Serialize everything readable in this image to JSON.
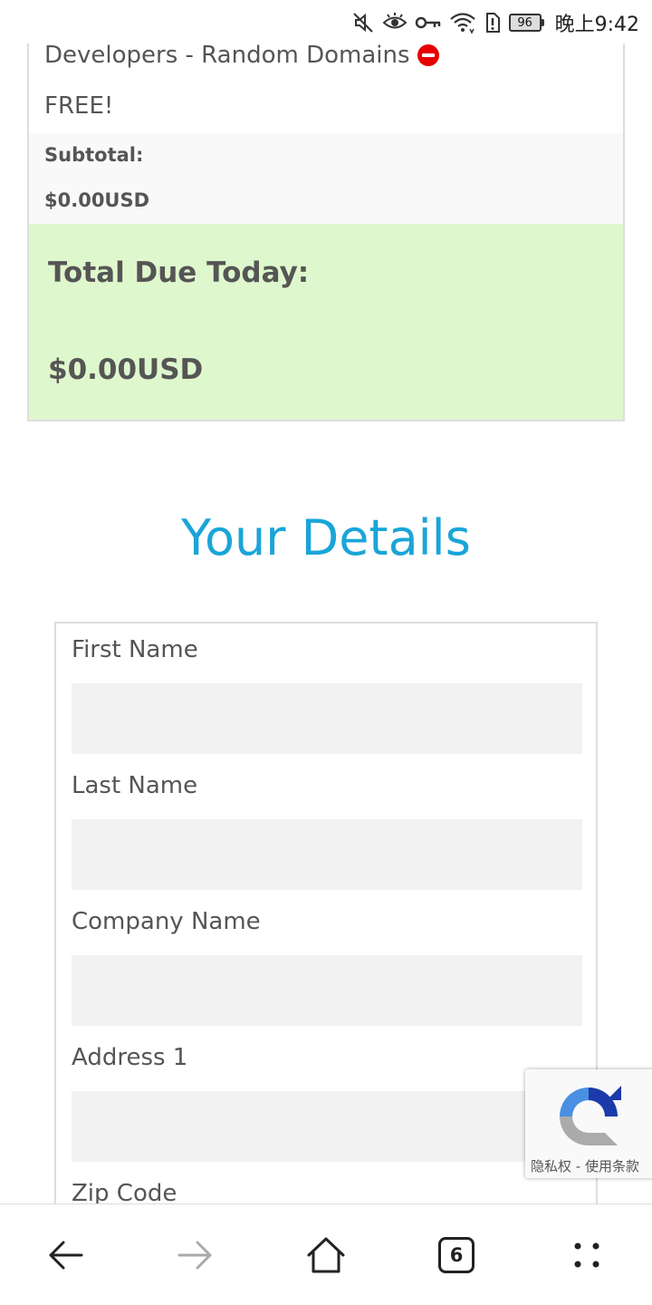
{
  "status_bar": {
    "battery_level": "96",
    "time": "晚上9:42",
    "icons": [
      "mute-icon",
      "eye-icon",
      "key-icon",
      "wifi-icon",
      "alert-icon",
      "battery-icon"
    ]
  },
  "order_summary": {
    "product_name": "Developers - Random Domains",
    "product_price": "FREE!",
    "subtotal_label": "Subtotal:",
    "subtotal_value": "$0.00USD",
    "total_label": "Total Due Today:",
    "total_value": "$0.00USD",
    "colors": {
      "total_background": "#dff7cc",
      "remove_icon": "#e60000"
    }
  },
  "details": {
    "title": "Your Details",
    "title_color": "#1aa5d8",
    "fields": {
      "first_name": {
        "label": "First Name",
        "value": ""
      },
      "last_name": {
        "label": "Last Name",
        "value": ""
      },
      "company_name": {
        "label": "Company Name",
        "value": ""
      },
      "address_1": {
        "label": "Address 1",
        "value": ""
      },
      "zip_code": {
        "label": "Zip Code"
      }
    }
  },
  "recaptcha": {
    "links": "隐私权 - 使用条款"
  },
  "bottom_nav": {
    "tab_count": "6",
    "icons": [
      "back-arrow-icon",
      "forward-arrow-icon",
      "home-icon",
      "tabs-icon",
      "more-icon"
    ]
  }
}
